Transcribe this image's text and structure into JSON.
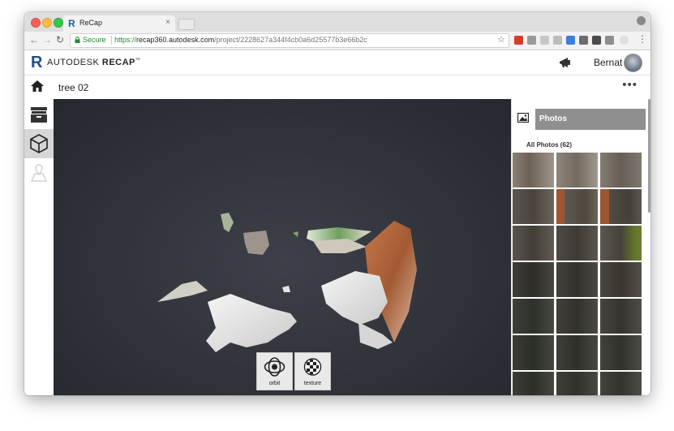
{
  "browser": {
    "tab_title": "ReCap",
    "tab_close": "×",
    "url_secure_label": "Secure",
    "url_scheme": "https://",
    "url_host": "recap360.autodesk.com",
    "url_path": "/project/2228627a344f4cb0a6d25577b3e66b2c"
  },
  "app": {
    "brand_name": "AUTODESK",
    "product_name": "RECAP",
    "trademark": "™",
    "username": "Bernat"
  },
  "project": {
    "title": "tree 02",
    "more": "•••"
  },
  "viewer": {
    "buttons": [
      {
        "label": "orbit",
        "icon": "orbit-icon"
      },
      {
        "label": "texture",
        "icon": "texture-icon"
      }
    ]
  },
  "panel": {
    "header_title": "Photos",
    "all_photos_label": "All Photos (62)"
  },
  "colors": {
    "accent": "#1b4f8a",
    "secure_green": "#1e8b34",
    "viewer_bg": "#2d2f37",
    "panel_header": "#8f8f8f"
  }
}
